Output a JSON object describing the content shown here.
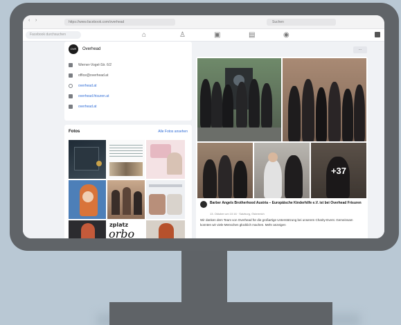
{
  "browser": {
    "address": "https://www.facebook.com/overhead",
    "search_placeholder": "Suchen",
    "nav_back": "‹",
    "nav_forward": "›"
  },
  "fb": {
    "search_placeholder": "Facebook durchsuchen"
  },
  "page": {
    "name": "Overhead",
    "logo_text": "OVR",
    "action_label": "···"
  },
  "intro": {
    "rows": [
      {
        "icon": "location-icon",
        "text": "Werner-Vogel-Str. 6/2",
        "is_link": false
      },
      {
        "icon": "email-icon",
        "text": "office@overhead.at",
        "is_link": false
      },
      {
        "icon": "globe-icon",
        "text": "overhead.at",
        "is_link": true
      },
      {
        "icon": "instagram-icon",
        "text": "overhead.frisuren.at",
        "is_link": true
      },
      {
        "icon": "link-icon",
        "text": "overhead.at",
        "is_link": true
      }
    ]
  },
  "photos": {
    "title": "Fotos",
    "see_all": "Alle Fotos ansehen",
    "thumb_text": "zplatz",
    "thumb_text2": "orbo"
  },
  "post": {
    "more_count": "+37",
    "author": "Barber Angels Brotherhood Austria – Europäische Kinderhilfe e.V. ist bei Overhead Frisuren",
    "date": "13. Oktober um 10:16 · Salzburg, Österreich",
    "text": "Wir danken dem Team von Overhead für die großartige Unterstützung bei unserem Charity-Event. Gemeinsam konnten wir viele Menschen glücklich machen. Mehr anzeigen"
  },
  "colors": {
    "accent": "#2f6cd6",
    "bezel": "#606468",
    "background": "#b9c8d4"
  }
}
